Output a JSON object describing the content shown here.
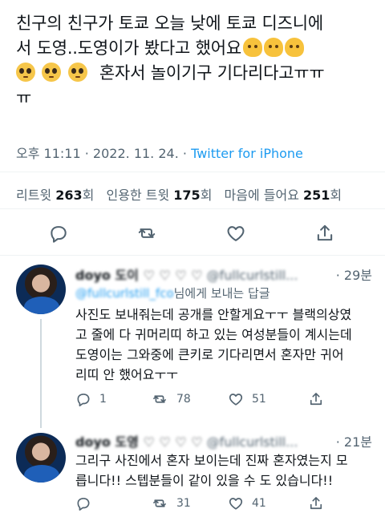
{
  "tweet": {
    "text_lines": [
      "친구의 친구가 토쿄 오늘 낮에 토쿄 디즈니에",
      "서 도영..도영이가 봤다고 했어요",
      "혼자서 놀이기구 기다리다고ㅠㅠ",
      "ㅠ"
    ],
    "emoji_melting": "melting-face-emoji",
    "emoji_pleading": "pleading-face-emoji",
    "time": "오후 11:11",
    "dot": "·",
    "date": "2022. 11. 24.",
    "source": "Twitter for iPhone"
  },
  "stats": {
    "retweets_label": "리트윗",
    "retweets_count": "263",
    "retweets_unit": "회",
    "quotes_label": "인용한 트윗",
    "quotes_count": "175",
    "quotes_unit": "회",
    "likes_label": "마음에 들어요",
    "likes_count": "251",
    "likes_unit": "회"
  },
  "colors": {
    "link": "#1d9bf0",
    "muted": "#536471",
    "text": "#0f1419",
    "divider": "#eff3f4"
  },
  "replies": [
    {
      "name": "doyo 도이 ♡ ♡ ♡ ♡",
      "handle": "@fullcurlstill...",
      "time": "· 29분",
      "to_prefix": "@",
      "to_handles": "fullcurlstill_fco",
      "to_suffix": "님에게 보내는 답글",
      "text_lines": [
        "사진도 보내줘는데 공개를 안할게요ㅜㅜ 블랙의상였",
        "고 줄에 다 귀머리띠 하고 있는 여성분들이 계시는데",
        "도영이는 그와중에 큰키로 기다리면서 혼자만 귀어",
        "리띠 안 했어요ㅜㅜ"
      ],
      "replies_count": "1",
      "retweets_count": "78",
      "likes_count": "51"
    },
    {
      "name": "doyo 도영 ♡ ♡ ♡ ♡",
      "handle": "@fullcurlstill...",
      "time": "· 21분",
      "text_lines": [
        "그리구 사진에서 혼자 보이는데 진짜 혼자였는지 모",
        "릅니다!! 스텝분들이 같이 있을 수 도 있습니다!!"
      ],
      "replies_count": "",
      "retweets_count": "31",
      "likes_count": "41"
    }
  ]
}
